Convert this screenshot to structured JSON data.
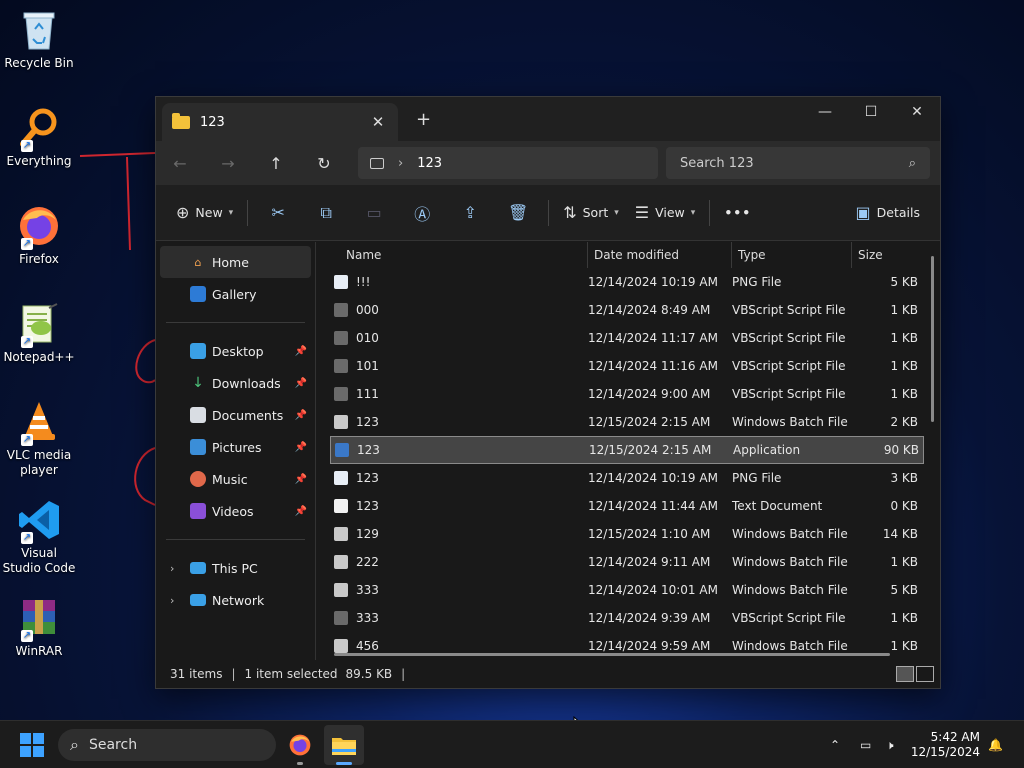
{
  "desktop": {
    "icons": [
      {
        "label": "Recycle Bin",
        "icon": "recycle-bin-icon"
      },
      {
        "label": "Everything",
        "icon": "everything-search-icon"
      },
      {
        "label": "Firefox",
        "icon": "firefox-icon"
      },
      {
        "label": "Notepad++",
        "icon": "notepad-plus-plus-icon"
      },
      {
        "label": "VLC media player",
        "icon": "vlc-icon"
      },
      {
        "label": "Visual Studio Code",
        "icon": "vscode-icon"
      },
      {
        "label": "WinRAR",
        "icon": "winrar-icon"
      }
    ]
  },
  "window": {
    "tab_title": "123",
    "address": {
      "crumb": "123"
    },
    "search_placeholder": "Search 123",
    "toolbar": {
      "new_label": "New",
      "sort_label": "Sort",
      "view_label": "View",
      "more_label": "•••",
      "details_label": "Details"
    },
    "nav": {
      "home": "Home",
      "gallery": "Gallery",
      "desktop": "Desktop",
      "downloads": "Downloads",
      "documents": "Documents",
      "pictures": "Pictures",
      "music": "Music",
      "videos": "Videos",
      "this_pc": "This PC",
      "network": "Network"
    },
    "columns": {
      "name": "Name",
      "date": "Date modified",
      "type": "Type",
      "size": "Size"
    },
    "files": [
      {
        "name": "!!!",
        "date": "12/14/2024 10:19 AM",
        "type": "PNG File",
        "size": "5 KB",
        "kind": "png"
      },
      {
        "name": "000",
        "date": "12/14/2024 8:49 AM",
        "type": "VBScript Script File",
        "size": "1 KB",
        "kind": "vbs"
      },
      {
        "name": "010",
        "date": "12/14/2024 11:17 AM",
        "type": "VBScript Script File",
        "size": "1 KB",
        "kind": "vbs"
      },
      {
        "name": "101",
        "date": "12/14/2024 11:16 AM",
        "type": "VBScript Script File",
        "size": "1 KB",
        "kind": "vbs"
      },
      {
        "name": "111",
        "date": "12/14/2024 9:00 AM",
        "type": "VBScript Script File",
        "size": "1 KB",
        "kind": "vbs"
      },
      {
        "name": "123",
        "date": "12/15/2024 2:15 AM",
        "type": "Windows Batch File",
        "size": "2 KB",
        "kind": "bat"
      },
      {
        "name": "123",
        "date": "12/15/2024 2:15 AM",
        "type": "Application",
        "size": "90 KB",
        "kind": "exe",
        "selected": true
      },
      {
        "name": "123",
        "date": "12/14/2024 10:19 AM",
        "type": "PNG File",
        "size": "3 KB",
        "kind": "png"
      },
      {
        "name": "123",
        "date": "12/14/2024 11:44 AM",
        "type": "Text Document",
        "size": "0 KB",
        "kind": "txt"
      },
      {
        "name": "129",
        "date": "12/15/2024 1:10 AM",
        "type": "Windows Batch File",
        "size": "14 KB",
        "kind": "bat"
      },
      {
        "name": "222",
        "date": "12/14/2024 9:11 AM",
        "type": "Windows Batch File",
        "size": "1 KB",
        "kind": "bat"
      },
      {
        "name": "333",
        "date": "12/14/2024 10:01 AM",
        "type": "Windows Batch File",
        "size": "5 KB",
        "kind": "bat"
      },
      {
        "name": "333",
        "date": "12/14/2024 9:39 AM",
        "type": "VBScript Script File",
        "size": "1 KB",
        "kind": "vbs"
      },
      {
        "name": "456",
        "date": "12/14/2024 9:59 AM",
        "type": "Windows Batch File",
        "size": "1 KB",
        "kind": "bat"
      }
    ],
    "status": {
      "count": "31 items",
      "selection": "1 item selected",
      "sel_size": "89.5 KB"
    }
  },
  "taskbar": {
    "search_label": "Search",
    "time": "5:42 AM",
    "date": "12/15/2024"
  },
  "colors": {
    "accent": "#3da2ff",
    "folder": "#f3c13a",
    "selected_row": "#454545"
  }
}
